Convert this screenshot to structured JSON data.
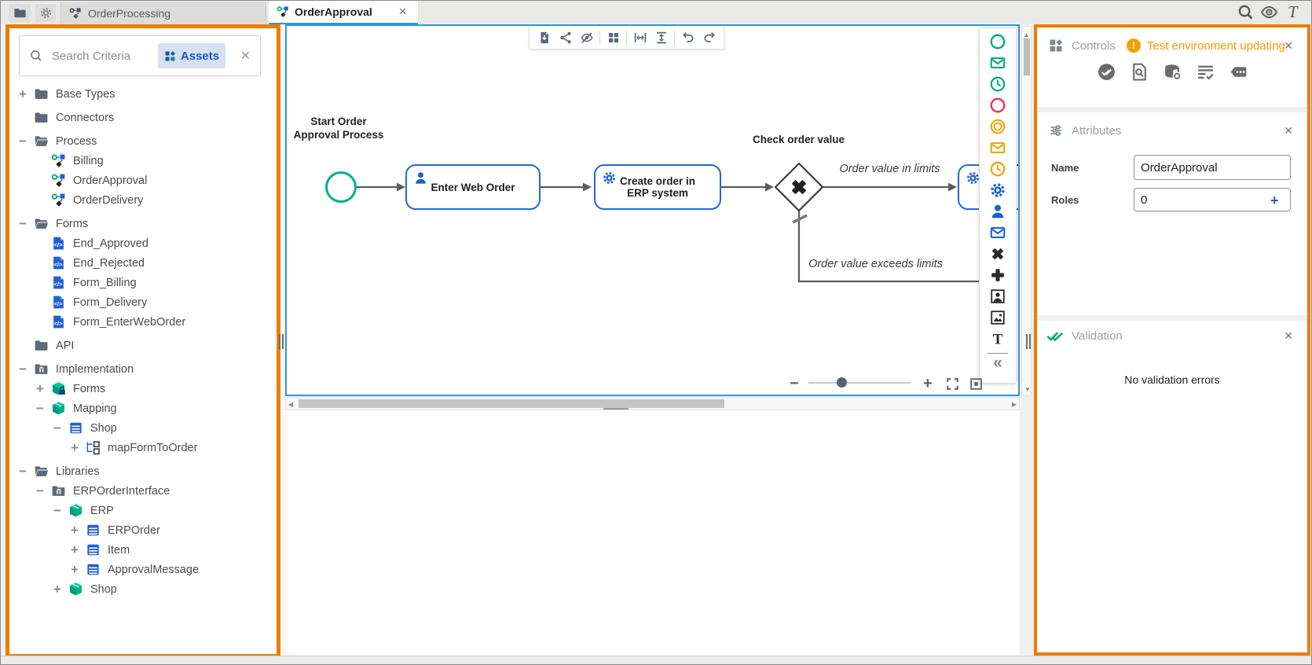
{
  "ui": {
    "close": "✕",
    "collapse": "«",
    "up": "▲",
    "down": "▼",
    "left": "◀",
    "right": "▶"
  },
  "topbar": {
    "tabs": [
      {
        "label": "OrderProcessing",
        "active": false
      },
      {
        "label": "OrderApproval",
        "active": true
      }
    ],
    "right_icons": [
      {
        "name": "search-icon",
        "kind": "magnify"
      },
      {
        "name": "preview-eye-icon",
        "kind": "eye"
      },
      {
        "name": "text-tool-icon",
        "kind": "letter-t-italic"
      }
    ]
  },
  "left_panel": {
    "search_placeholder": "Search Criteria",
    "filter_chip": "Assets",
    "tree": [
      {
        "label": "Base Types",
        "icon": "folder",
        "level": 0,
        "expander": "+",
        "group": true
      },
      {
        "label": "Connectors",
        "icon": "folder",
        "level": 0,
        "expander": "",
        "group": true
      },
      {
        "label": "Process",
        "icon": "folder-open",
        "level": 0,
        "expander": "-",
        "group": true
      },
      {
        "label": "Billing",
        "icon": "process",
        "level": 1,
        "expander": ""
      },
      {
        "label": "OrderApproval",
        "icon": "process",
        "level": 1,
        "expander": ""
      },
      {
        "label": "OrderDelivery",
        "icon": "process",
        "level": 1,
        "expander": ""
      },
      {
        "label": "Forms",
        "icon": "folder-open",
        "level": 0,
        "expander": "-",
        "group": true
      },
      {
        "label": "End_Approved",
        "icon": "form",
        "level": 1,
        "expander": ""
      },
      {
        "label": "End_Rejected",
        "icon": "form",
        "level": 1,
        "expander": ""
      },
      {
        "label": "Form_Billing",
        "icon": "form",
        "level": 1,
        "expander": ""
      },
      {
        "label": "Form_Delivery",
        "icon": "form",
        "level": 1,
        "expander": ""
      },
      {
        "label": "Form_EnterWebOrder",
        "icon": "form",
        "level": 1,
        "expander": ""
      },
      {
        "label": "API",
        "icon": "folder",
        "level": 0,
        "expander": "",
        "group": true
      },
      {
        "label": "Implementation",
        "icon": "folder-lib",
        "level": 0,
        "expander": "-",
        "group": true
      },
      {
        "label": "Forms",
        "icon": "box-lock",
        "level": 1,
        "expander": "+"
      },
      {
        "label": "Mapping",
        "icon": "box",
        "level": 1,
        "expander": "-"
      },
      {
        "label": "Shop",
        "icon": "table",
        "level": 2,
        "expander": "-"
      },
      {
        "label": "mapFormToOrder",
        "icon": "mapping",
        "level": 3,
        "expander": "+"
      },
      {
        "label": "Libraries",
        "icon": "folder-open",
        "level": 0,
        "expander": "-",
        "group": true
      },
      {
        "label": "ERPOrderInterface",
        "icon": "folder-lib",
        "level": 1,
        "expander": "-"
      },
      {
        "label": "ERP",
        "icon": "box",
        "level": 2,
        "expander": "-"
      },
      {
        "label": "ERPOrder",
        "icon": "table",
        "level": 3,
        "expander": "+"
      },
      {
        "label": "Item",
        "icon": "table",
        "level": 3,
        "expander": "+"
      },
      {
        "label": "ApprovalMessage",
        "icon": "table",
        "level": 3,
        "expander": "+"
      },
      {
        "label": "Shop",
        "icon": "box",
        "level": 2,
        "expander": "+"
      }
    ]
  },
  "canvas": {
    "toolbar_icons": [
      {
        "name": "import-document-icon",
        "kind": "import-doc",
        "sep_after": false
      },
      {
        "name": "share-icon",
        "kind": "share",
        "sep_after": false
      },
      {
        "name": "hide-elements-icon",
        "kind": "eye-off",
        "sep_after": true
      },
      {
        "name": "grid-layout-icon",
        "kind": "grid",
        "sep_after": true
      },
      {
        "name": "fit-width-icon",
        "kind": "fit-w",
        "sep_after": false
      },
      {
        "name": "fit-height-icon",
        "kind": "fit-h",
        "sep_after": true
      },
      {
        "name": "undo-icon",
        "kind": "undo",
        "sep_after": false
      },
      {
        "name": "redo-icon",
        "kind": "redo",
        "sep_after": false
      }
    ],
    "diagram": {
      "start_label_line1": "Start Order",
      "start_label_line2": "Approval Process",
      "task1": "Enter Web Order",
      "task2": "Create order in ERP system",
      "gateway_label": "Check order value",
      "edge_yes": "Order value in limits",
      "edge_no": "Order value exceeds limits"
    }
  },
  "palette": {
    "items": [
      {
        "name": "start-event-icon",
        "kind": "circle",
        "color": "#00a884"
      },
      {
        "name": "message-start-event-icon",
        "kind": "envelope",
        "color": "#00a884"
      },
      {
        "name": "timer-start-event-icon",
        "kind": "clock",
        "color": "#00a884"
      },
      {
        "name": "end-event-icon",
        "kind": "circle",
        "color": "#e8325a"
      },
      {
        "name": "intermediate-event-icon",
        "kind": "circle2",
        "color": "#f0a202"
      },
      {
        "name": "message-intermediate-event-icon",
        "kind": "envelope",
        "color": "#f0a202"
      },
      {
        "name": "timer-intermediate-event-icon",
        "kind": "clock",
        "color": "#f0a202"
      },
      {
        "name": "service-task-icon",
        "kind": "gear",
        "color": "#1565d0"
      },
      {
        "name": "user-task-icon",
        "kind": "person",
        "color": "#1565d0"
      },
      {
        "name": "message-task-icon",
        "kind": "envelope",
        "color": "#1565d0"
      },
      {
        "name": "exclusive-gateway-icon",
        "kind": "xmark",
        "color": "#2b2b2b"
      },
      {
        "name": "parallel-gateway-icon",
        "kind": "plus",
        "color": "#2b2b2b"
      },
      {
        "name": "participant-icon",
        "kind": "person-frame",
        "color": "#2b2b2b"
      },
      {
        "name": "image-icon",
        "kind": "image-frame",
        "color": "#2b2b2b"
      },
      {
        "name": "text-annotation-icon",
        "kind": "letter-t",
        "color": "#2b2b2b"
      }
    ]
  },
  "right_panel": {
    "controls": {
      "title": "Controls",
      "warning": "Test environment updating",
      "icons": [
        {
          "name": "test-run-icon",
          "kind": "verified"
        },
        {
          "name": "inspect-document-icon",
          "kind": "doc-search"
        },
        {
          "name": "database-reset-icon",
          "kind": "db-x"
        },
        {
          "name": "test-list-icon",
          "kind": "list-check"
        },
        {
          "name": "console-log-icon",
          "kind": "tag-dots"
        }
      ]
    },
    "attributes": {
      "title": "Attributes",
      "name_label": "Name",
      "name_value": "OrderApproval",
      "roles_label": "Roles",
      "roles_value": "0",
      "roles_add": "+"
    },
    "validation": {
      "title": "Validation",
      "message": "No validation errors"
    }
  }
}
